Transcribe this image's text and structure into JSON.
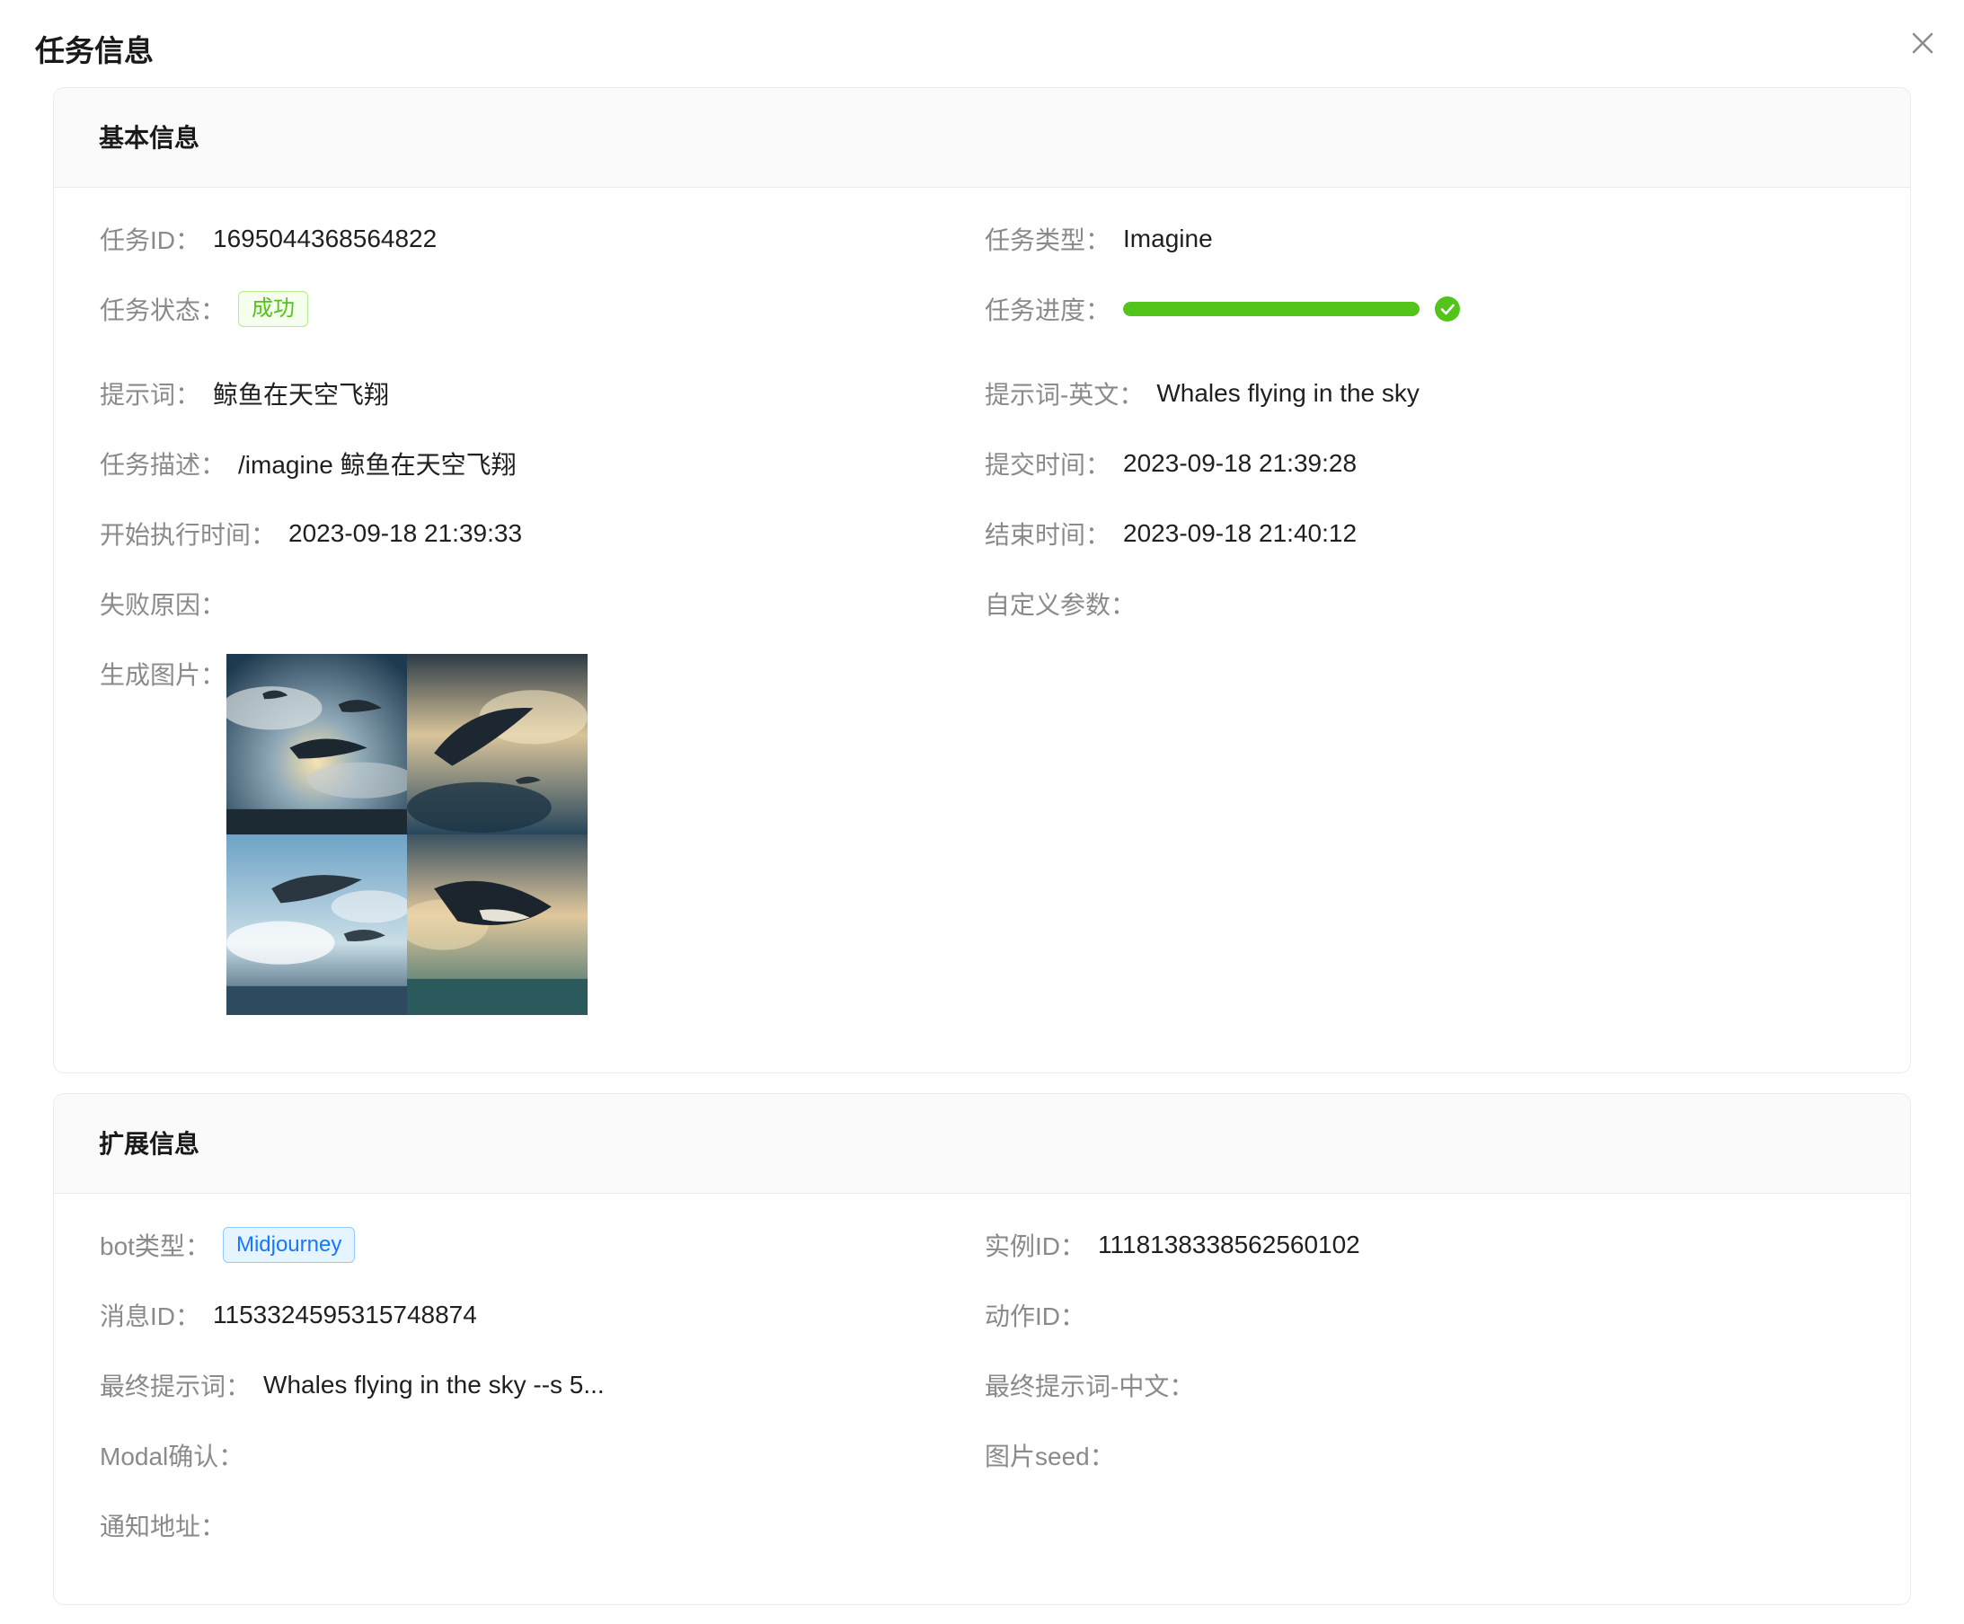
{
  "modal": {
    "title": "任务信息"
  },
  "basic": {
    "title": "基本信息",
    "task_id": {
      "label": "任务ID",
      "value": "1695044368564822"
    },
    "task_type": {
      "label": "任务类型",
      "value": "Imagine"
    },
    "task_status": {
      "label": "任务状态",
      "value": "成功",
      "color": "#52c41a"
    },
    "task_progress": {
      "label": "任务进度",
      "value": 1.0,
      "color": "#52c41a",
      "icon": "check-circle-icon"
    },
    "prompt": {
      "label": "提示词",
      "value": "鲸鱼在天空飞翔"
    },
    "prompt_en": {
      "label": "提示词-英文",
      "value": "Whales flying in the sky"
    },
    "description": {
      "label": "任务描述",
      "value": "/imagine 鲸鱼在天空飞翔"
    },
    "submit_time": {
      "label": "提交时间",
      "value": "2023-09-18 21:39:28"
    },
    "start_time": {
      "label": "开始执行时间",
      "value": "2023-09-18 21:39:33"
    },
    "finish_time": {
      "label": "结束时间",
      "value": "2023-09-18 21:40:12"
    },
    "fail_reason": {
      "label": "失败原因",
      "value": ""
    },
    "custom_params": {
      "label": "自定义参数",
      "value": ""
    },
    "image": {
      "label": "生成图片"
    }
  },
  "extended": {
    "title": "扩展信息",
    "bot_type": {
      "label": "bot类型",
      "value": "Midjourney",
      "color": "#1677ff"
    },
    "instance_id": {
      "label": "实例ID",
      "value": "1118138338562560102"
    },
    "message_id": {
      "label": "消息ID",
      "value": "1153324595315748874"
    },
    "action_id": {
      "label": "动作ID",
      "value": ""
    },
    "final_prompt": {
      "label": "最终提示词",
      "value": "Whales flying in the sky --s 5..."
    },
    "final_prompt_zh": {
      "label": "最终提示词-中文",
      "value": ""
    },
    "modal_confirm": {
      "label": "Modal确认",
      "value": ""
    },
    "image_seed": {
      "label": "图片seed",
      "value": ""
    },
    "notify_url": {
      "label": "通知地址",
      "value": ""
    }
  },
  "colon": "："
}
